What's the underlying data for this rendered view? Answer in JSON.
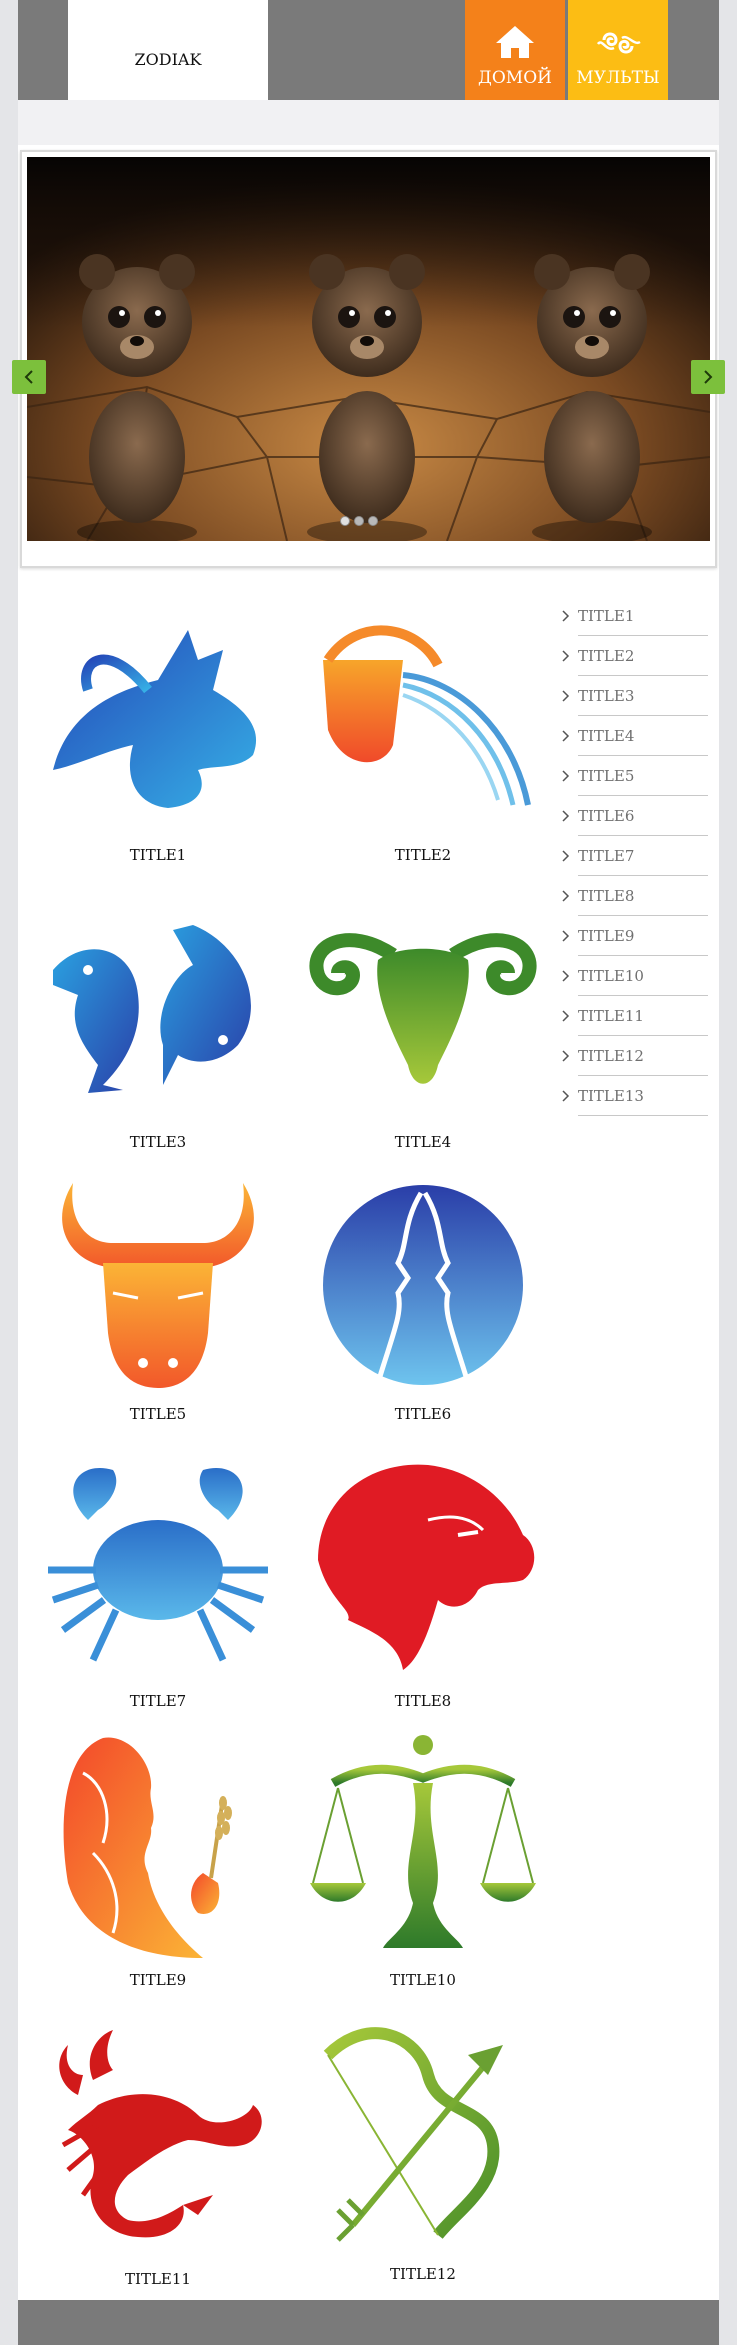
{
  "header": {
    "logo_text": "ZODIAK",
    "nav": [
      {
        "label": "ДОМОЙ",
        "icon": "home-icon"
      },
      {
        "label": "МУЛЬТЫ",
        "icon": "swirl-icon"
      }
    ]
  },
  "slider": {
    "active_index": 0,
    "dot_count": 3
  },
  "signs": [
    {
      "title": "TITLE1",
      "icon": "capricorn-icon",
      "color": "#2f7fd1"
    },
    {
      "title": "TITLE2",
      "icon": "aquarius-icon",
      "color": "#f07f2a"
    },
    {
      "title": "TITLE3",
      "icon": "pisces-icon",
      "color": "#2f6fd0"
    },
    {
      "title": "TITLE4",
      "icon": "aries-icon",
      "color": "#6aa32f"
    },
    {
      "title": "TITLE5",
      "icon": "taurus-icon",
      "color": "#f58a2a"
    },
    {
      "title": "TITLE6",
      "icon": "gemini-icon",
      "color": "#2d63c2"
    },
    {
      "title": "TITLE7",
      "icon": "cancer-icon",
      "color": "#2f8fd8"
    },
    {
      "title": "TITLE8",
      "icon": "leo-icon",
      "color": "#e11d24"
    },
    {
      "title": "TITLE9",
      "icon": "virgo-icon",
      "color": "#f36a2a"
    },
    {
      "title": "TITLE10",
      "icon": "libra-icon",
      "color": "#5f9e2f"
    },
    {
      "title": "TITLE11",
      "icon": "scorpio-icon",
      "color": "#d11a1a"
    },
    {
      "title": "TITLE12",
      "icon": "sagittarius-icon",
      "color": "#6aa32f"
    }
  ],
  "sidebar": {
    "items": [
      "TITLE1",
      "TITLE2",
      "TITLE3",
      "TITLE4",
      "TITLE5",
      "TITLE6",
      "TITLE7",
      "TITLE8",
      "TITLE9",
      "TITLE10",
      "TITLE11",
      "TITLE12",
      "TITLE13"
    ]
  }
}
